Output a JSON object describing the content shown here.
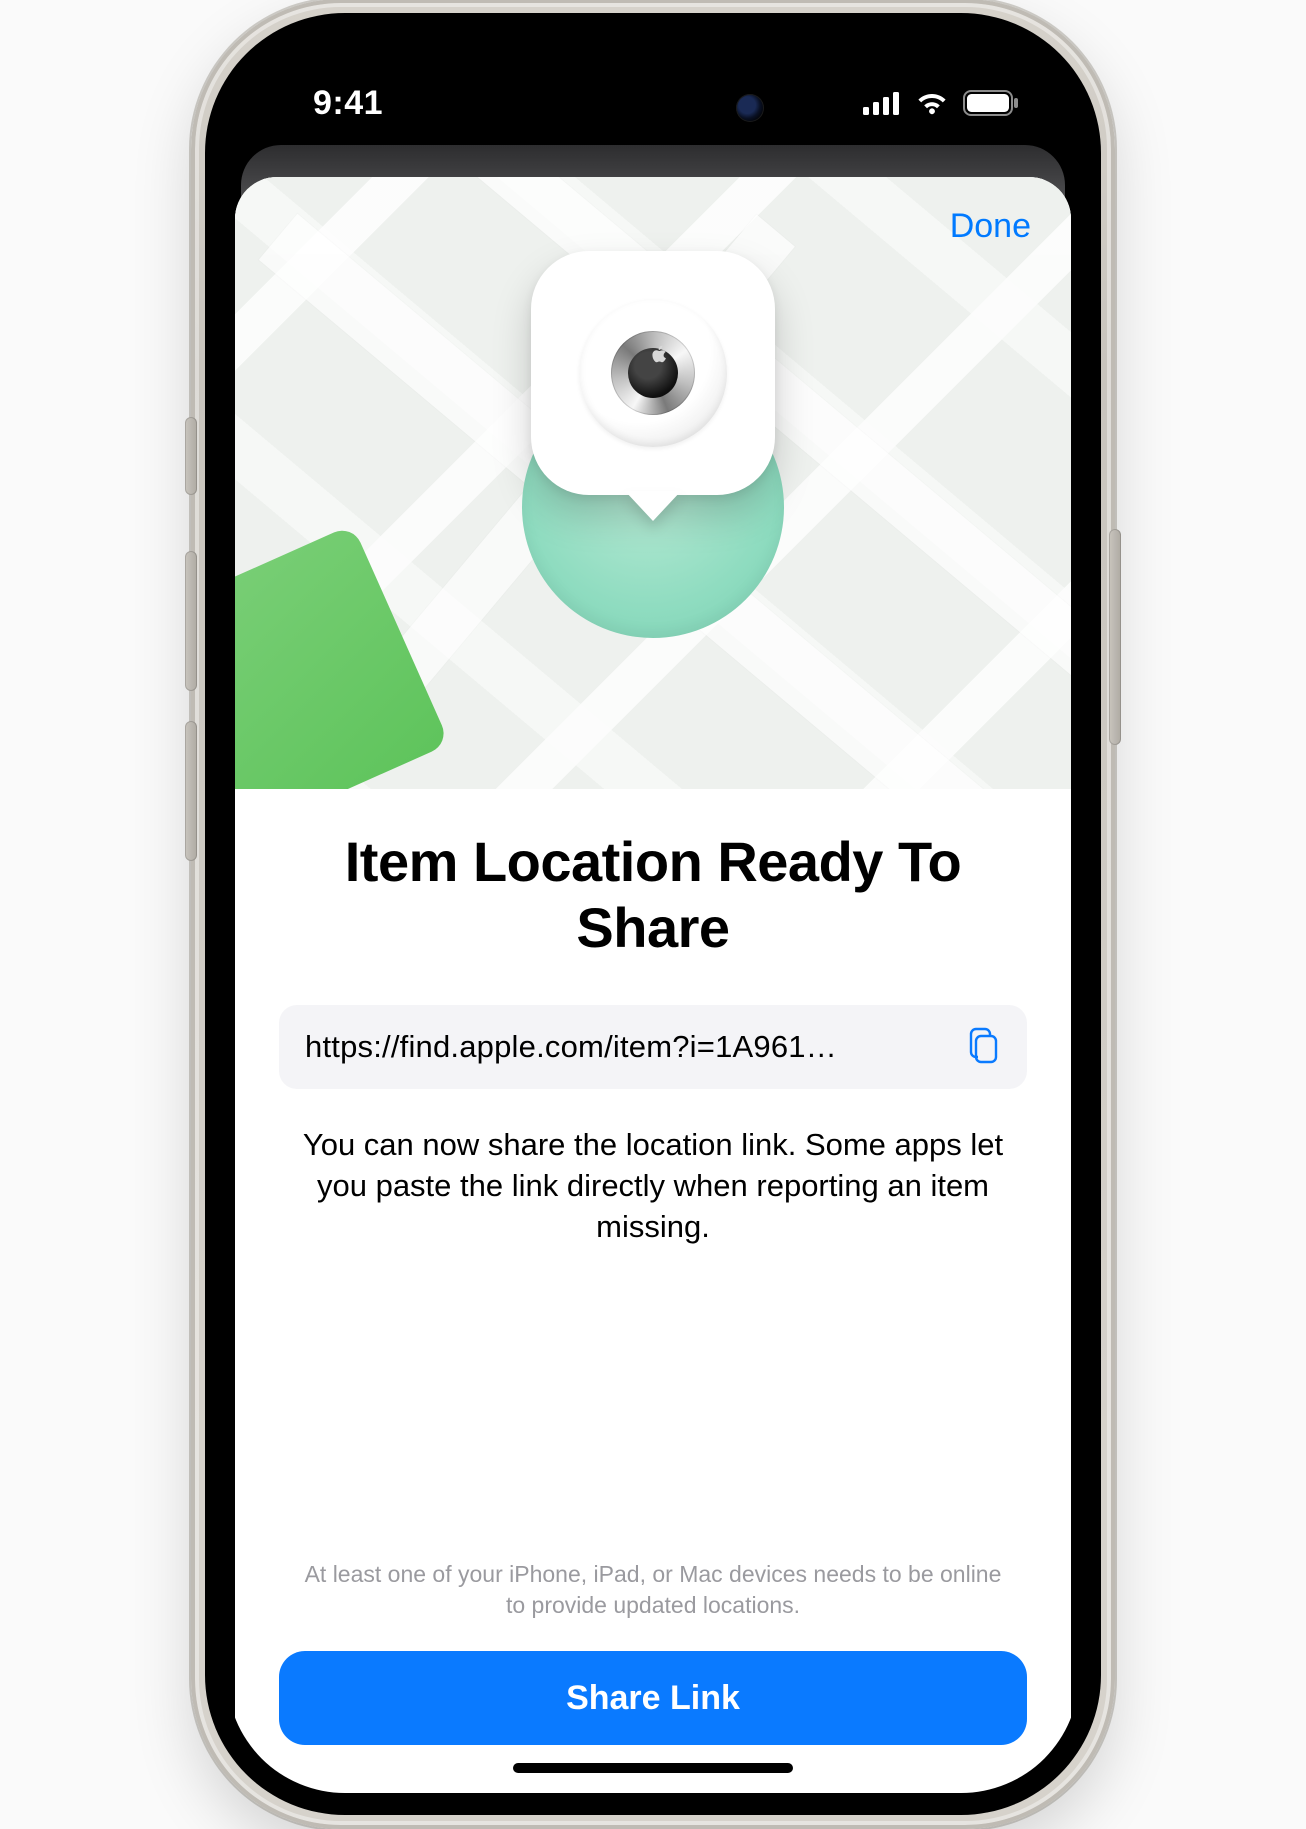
{
  "status": {
    "time": "9:41"
  },
  "nav": {
    "done": "Done"
  },
  "sheet": {
    "title": "Item Location Ready To Share",
    "link_url": "https://find.apple.com/item?i=1A961…",
    "description": "You can now share the location link. Some apps let you paste the link directly when reporting an item missing.",
    "footnote": "At least one of your iPhone, iPad, or Mac devices needs to be online to provide updated locations.",
    "share_button": "Share Link"
  },
  "colors": {
    "accent": "#0a7aff",
    "radius_fill": "#8fdcc0"
  }
}
